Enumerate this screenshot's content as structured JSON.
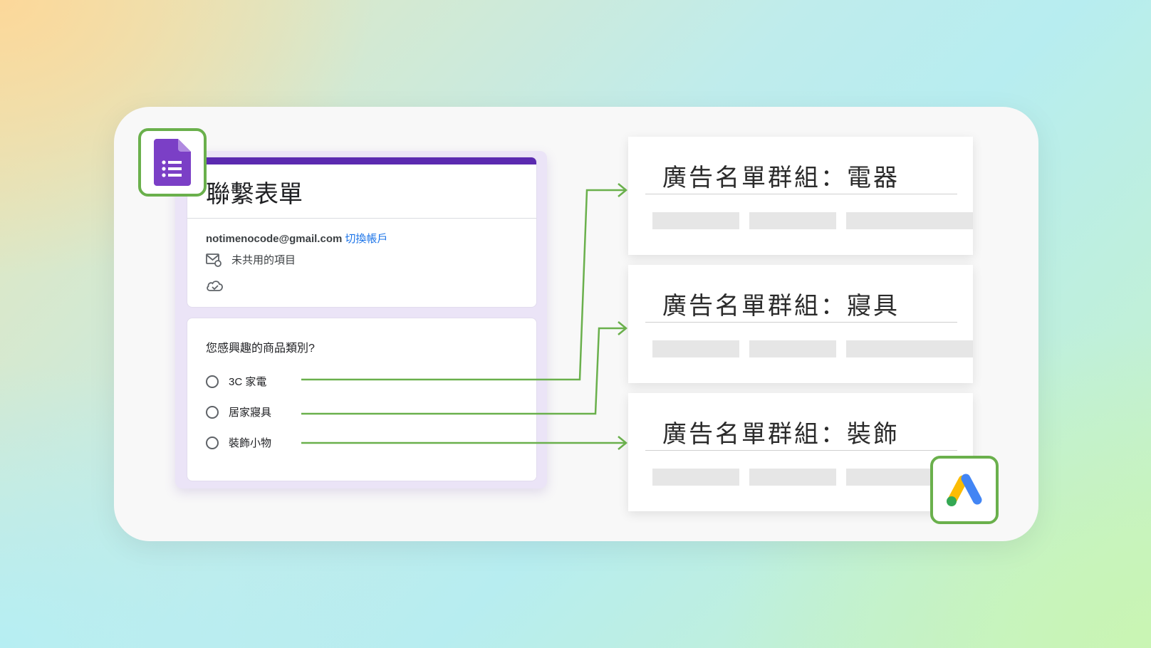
{
  "form": {
    "title": "聯繫表單",
    "email": "notimenocode@gmail.com",
    "switch_account": "切換帳戶",
    "not_shared": "未共用的項目",
    "question": "您感興趣的商品類別?",
    "options": [
      "3C 家電",
      "居家寢具",
      "裝飾小物"
    ],
    "accent_color": "#5b2ab0"
  },
  "groups": [
    {
      "title": "廣告名單群組：電器"
    },
    {
      "title": "廣告名單群組：寢具"
    },
    {
      "title": "廣告名單群組：裝飾"
    }
  ],
  "icons": {
    "forms_logo": "google-forms-icon",
    "ads_logo": "google-ads-icon",
    "mail_icon": "mail-icon",
    "cloud_icon": "cloud-saved-icon"
  },
  "colors": {
    "connector": "#6ab04c",
    "badge_border": "#6ab04c"
  }
}
